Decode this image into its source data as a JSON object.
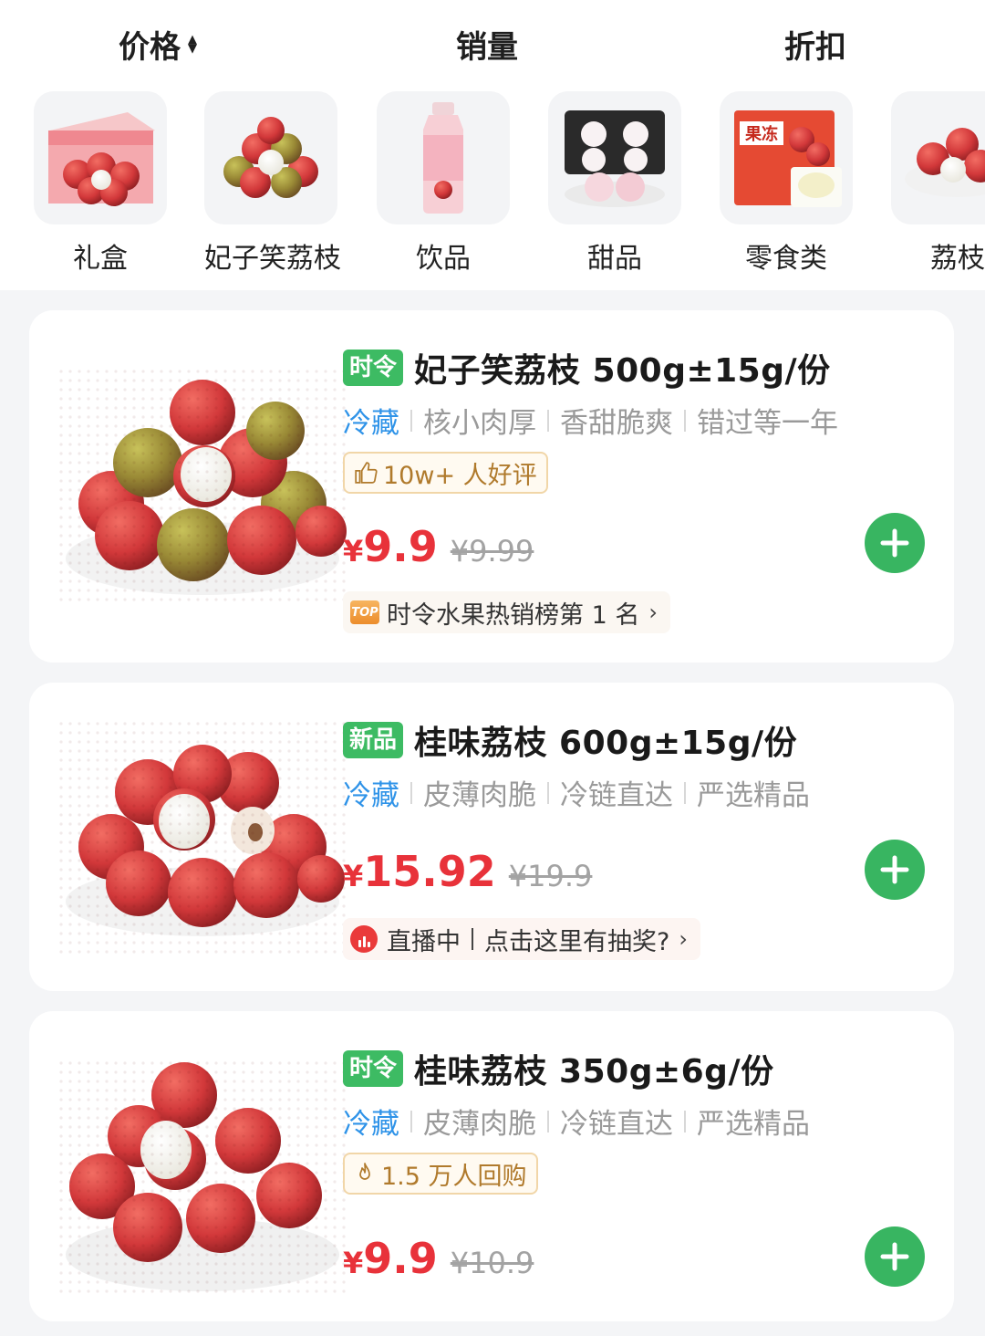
{
  "sort_bar": {
    "price_label": "价格",
    "sales_label": "销量",
    "discount_label": "折扣"
  },
  "categories": [
    {
      "label": "礼盒",
      "icon": "gift-box-lychee-image"
    },
    {
      "label": "妃子笑荔枝",
      "icon": "lychee-pile-image"
    },
    {
      "label": "饮品",
      "icon": "lychee-drink-bottle-image"
    },
    {
      "label": "甜品",
      "icon": "lychee-dessert-image"
    },
    {
      "label": "零食类",
      "icon": "lychee-jelly-snack-image"
    },
    {
      "label": "荔枝",
      "icon": "lychee-plate-image"
    }
  ],
  "products": [
    {
      "tag": "时令",
      "title": "妃子笑荔枝 500g±15g/份",
      "features": [
        "冷藏",
        "核小肉厚",
        "香甜脆爽",
        "错过等一年"
      ],
      "badge": "10w+ 人好评",
      "badge_icon": "thumbs-up-icon",
      "currency": "¥",
      "price": "9.9",
      "original_price": "¥9.99",
      "promo": "时令水果热销榜第 1 名",
      "promo_icon": "top-rank-icon"
    },
    {
      "tag": "新品",
      "title": "桂味荔枝 600g±15g/份",
      "features": [
        "冷藏",
        "皮薄肉脆",
        "冷链直达",
        "严选精品"
      ],
      "currency": "¥",
      "price": "15.92",
      "original_price": "¥19.9",
      "promo_live": "直播中",
      "promo_text": "点击这里有抽奖?",
      "promo_icon": "live-icon"
    },
    {
      "tag": "时令",
      "title": "桂味荔枝 350g±6g/份",
      "features": [
        "冷藏",
        "皮薄肉脆",
        "冷链直达",
        "严选精品"
      ],
      "badge": "1.5 万人回购",
      "badge_icon": "flame-icon",
      "currency": "¥",
      "price": "9.9",
      "original_price": "¥10.9"
    }
  ],
  "colors": {
    "tag_green": "#3dbb63",
    "price_red": "#e8323a",
    "cold_blue": "#2f93e8",
    "add_button_green": "#38b561"
  }
}
